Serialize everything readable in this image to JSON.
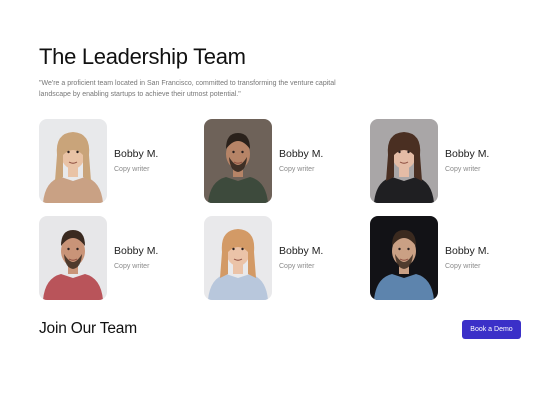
{
  "header": {
    "title": "The Leadership Team",
    "intro": "\"We're a proficient team located in San Francisco, committed to transforming the venture capital landscape by enabling startups to achieve their utmost potential.\""
  },
  "team": [
    {
      "name": "Bobby M.",
      "role": "Copy writer",
      "photo": {
        "bg": "#e8e9eb",
        "hair": "#c9a47a",
        "skin": "#e9c3a6",
        "top": "#c9a184"
      }
    },
    {
      "name": "Bobby M.",
      "role": "Copy writer",
      "photo": {
        "bg": "#6e6259",
        "hair": "#2a211b",
        "skin": "#b68467",
        "top": "#3d4a3c"
      }
    },
    {
      "name": "Bobby M.",
      "role": "Copy writer",
      "photo": {
        "bg": "#a9a6a7",
        "hair": "#4a2f22",
        "skin": "#e4bca6",
        "top": "#1f1f22"
      }
    },
    {
      "name": "Bobby M.",
      "role": "Copy writer",
      "photo": {
        "bg": "#e7e7e9",
        "hair": "#3a2a20",
        "skin": "#c99478",
        "top": "#b9545a"
      }
    },
    {
      "name": "Bobby M.",
      "role": "Copy writer",
      "photo": {
        "bg": "#e9e9eb",
        "hair": "#d39a66",
        "skin": "#ebc3a8",
        "top": "#b8c7dc"
      }
    },
    {
      "name": "Bobby M.",
      "role": "Copy writer",
      "photo": {
        "bg": "#121216",
        "hair": "#3b2a1f",
        "skin": "#caa084",
        "top": "#5d84ad"
      }
    }
  ],
  "footer": {
    "join_title": "Join Our Team",
    "cta_label": "Book a Demo"
  },
  "colors": {
    "accent": "#3b30c8",
    "text_dark": "#111111",
    "text_muted": "#8a8a8a"
  }
}
